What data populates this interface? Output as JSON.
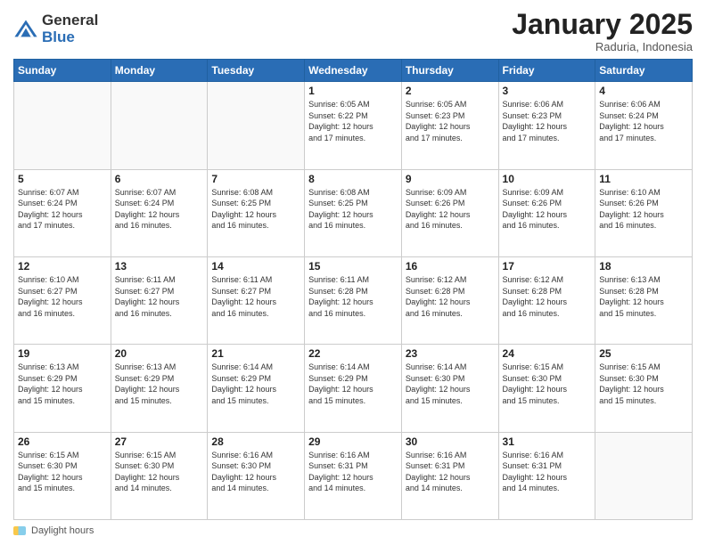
{
  "logo": {
    "general": "General",
    "blue": "Blue"
  },
  "header": {
    "month": "January 2025",
    "location": "Raduria, Indonesia"
  },
  "footer": {
    "label": "Daylight hours"
  },
  "days_of_week": [
    "Sunday",
    "Monday",
    "Tuesday",
    "Wednesday",
    "Thursday",
    "Friday",
    "Saturday"
  ],
  "weeks": [
    [
      {
        "day": "",
        "info": ""
      },
      {
        "day": "",
        "info": ""
      },
      {
        "day": "",
        "info": ""
      },
      {
        "day": "1",
        "info": "Sunrise: 6:05 AM\nSunset: 6:22 PM\nDaylight: 12 hours\nand 17 minutes."
      },
      {
        "day": "2",
        "info": "Sunrise: 6:05 AM\nSunset: 6:23 PM\nDaylight: 12 hours\nand 17 minutes."
      },
      {
        "day": "3",
        "info": "Sunrise: 6:06 AM\nSunset: 6:23 PM\nDaylight: 12 hours\nand 17 minutes."
      },
      {
        "day": "4",
        "info": "Sunrise: 6:06 AM\nSunset: 6:24 PM\nDaylight: 12 hours\nand 17 minutes."
      }
    ],
    [
      {
        "day": "5",
        "info": "Sunrise: 6:07 AM\nSunset: 6:24 PM\nDaylight: 12 hours\nand 17 minutes."
      },
      {
        "day": "6",
        "info": "Sunrise: 6:07 AM\nSunset: 6:24 PM\nDaylight: 12 hours\nand 16 minutes."
      },
      {
        "day": "7",
        "info": "Sunrise: 6:08 AM\nSunset: 6:25 PM\nDaylight: 12 hours\nand 16 minutes."
      },
      {
        "day": "8",
        "info": "Sunrise: 6:08 AM\nSunset: 6:25 PM\nDaylight: 12 hours\nand 16 minutes."
      },
      {
        "day": "9",
        "info": "Sunrise: 6:09 AM\nSunset: 6:26 PM\nDaylight: 12 hours\nand 16 minutes."
      },
      {
        "day": "10",
        "info": "Sunrise: 6:09 AM\nSunset: 6:26 PM\nDaylight: 12 hours\nand 16 minutes."
      },
      {
        "day": "11",
        "info": "Sunrise: 6:10 AM\nSunset: 6:26 PM\nDaylight: 12 hours\nand 16 minutes."
      }
    ],
    [
      {
        "day": "12",
        "info": "Sunrise: 6:10 AM\nSunset: 6:27 PM\nDaylight: 12 hours\nand 16 minutes."
      },
      {
        "day": "13",
        "info": "Sunrise: 6:11 AM\nSunset: 6:27 PM\nDaylight: 12 hours\nand 16 minutes."
      },
      {
        "day": "14",
        "info": "Sunrise: 6:11 AM\nSunset: 6:27 PM\nDaylight: 12 hours\nand 16 minutes."
      },
      {
        "day": "15",
        "info": "Sunrise: 6:11 AM\nSunset: 6:28 PM\nDaylight: 12 hours\nand 16 minutes."
      },
      {
        "day": "16",
        "info": "Sunrise: 6:12 AM\nSunset: 6:28 PM\nDaylight: 12 hours\nand 16 minutes."
      },
      {
        "day": "17",
        "info": "Sunrise: 6:12 AM\nSunset: 6:28 PM\nDaylight: 12 hours\nand 16 minutes."
      },
      {
        "day": "18",
        "info": "Sunrise: 6:13 AM\nSunset: 6:28 PM\nDaylight: 12 hours\nand 15 minutes."
      }
    ],
    [
      {
        "day": "19",
        "info": "Sunrise: 6:13 AM\nSunset: 6:29 PM\nDaylight: 12 hours\nand 15 minutes."
      },
      {
        "day": "20",
        "info": "Sunrise: 6:13 AM\nSunset: 6:29 PM\nDaylight: 12 hours\nand 15 minutes."
      },
      {
        "day": "21",
        "info": "Sunrise: 6:14 AM\nSunset: 6:29 PM\nDaylight: 12 hours\nand 15 minutes."
      },
      {
        "day": "22",
        "info": "Sunrise: 6:14 AM\nSunset: 6:29 PM\nDaylight: 12 hours\nand 15 minutes."
      },
      {
        "day": "23",
        "info": "Sunrise: 6:14 AM\nSunset: 6:30 PM\nDaylight: 12 hours\nand 15 minutes."
      },
      {
        "day": "24",
        "info": "Sunrise: 6:15 AM\nSunset: 6:30 PM\nDaylight: 12 hours\nand 15 minutes."
      },
      {
        "day": "25",
        "info": "Sunrise: 6:15 AM\nSunset: 6:30 PM\nDaylight: 12 hours\nand 15 minutes."
      }
    ],
    [
      {
        "day": "26",
        "info": "Sunrise: 6:15 AM\nSunset: 6:30 PM\nDaylight: 12 hours\nand 15 minutes."
      },
      {
        "day": "27",
        "info": "Sunrise: 6:15 AM\nSunset: 6:30 PM\nDaylight: 12 hours\nand 14 minutes."
      },
      {
        "day": "28",
        "info": "Sunrise: 6:16 AM\nSunset: 6:30 PM\nDaylight: 12 hours\nand 14 minutes."
      },
      {
        "day": "29",
        "info": "Sunrise: 6:16 AM\nSunset: 6:31 PM\nDaylight: 12 hours\nand 14 minutes."
      },
      {
        "day": "30",
        "info": "Sunrise: 6:16 AM\nSunset: 6:31 PM\nDaylight: 12 hours\nand 14 minutes."
      },
      {
        "day": "31",
        "info": "Sunrise: 6:16 AM\nSunset: 6:31 PM\nDaylight: 12 hours\nand 14 minutes."
      },
      {
        "day": "",
        "info": ""
      }
    ]
  ]
}
